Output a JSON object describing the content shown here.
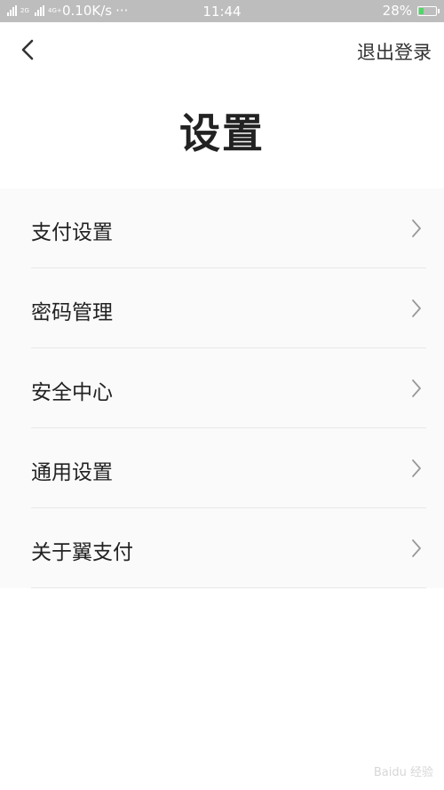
{
  "status_bar": {
    "net_tag_1": "2G",
    "net_tag_2": "4G+",
    "speed": "0.10K/s",
    "dots": "···",
    "time": "11:44",
    "battery_percent": "28%",
    "battery_level": 0.28
  },
  "nav": {
    "back_icon": "chevron-left-icon",
    "logout_label": "退出登录"
  },
  "page_title": "设置",
  "menu": {
    "items": [
      {
        "label": "支付设置"
      },
      {
        "label": "密码管理"
      },
      {
        "label": "安全中心"
      },
      {
        "label": "通用设置"
      },
      {
        "label": "关于翼支付"
      }
    ],
    "chevron_icon": "chevron-right-icon"
  },
  "watermark": "Baidu 经验"
}
